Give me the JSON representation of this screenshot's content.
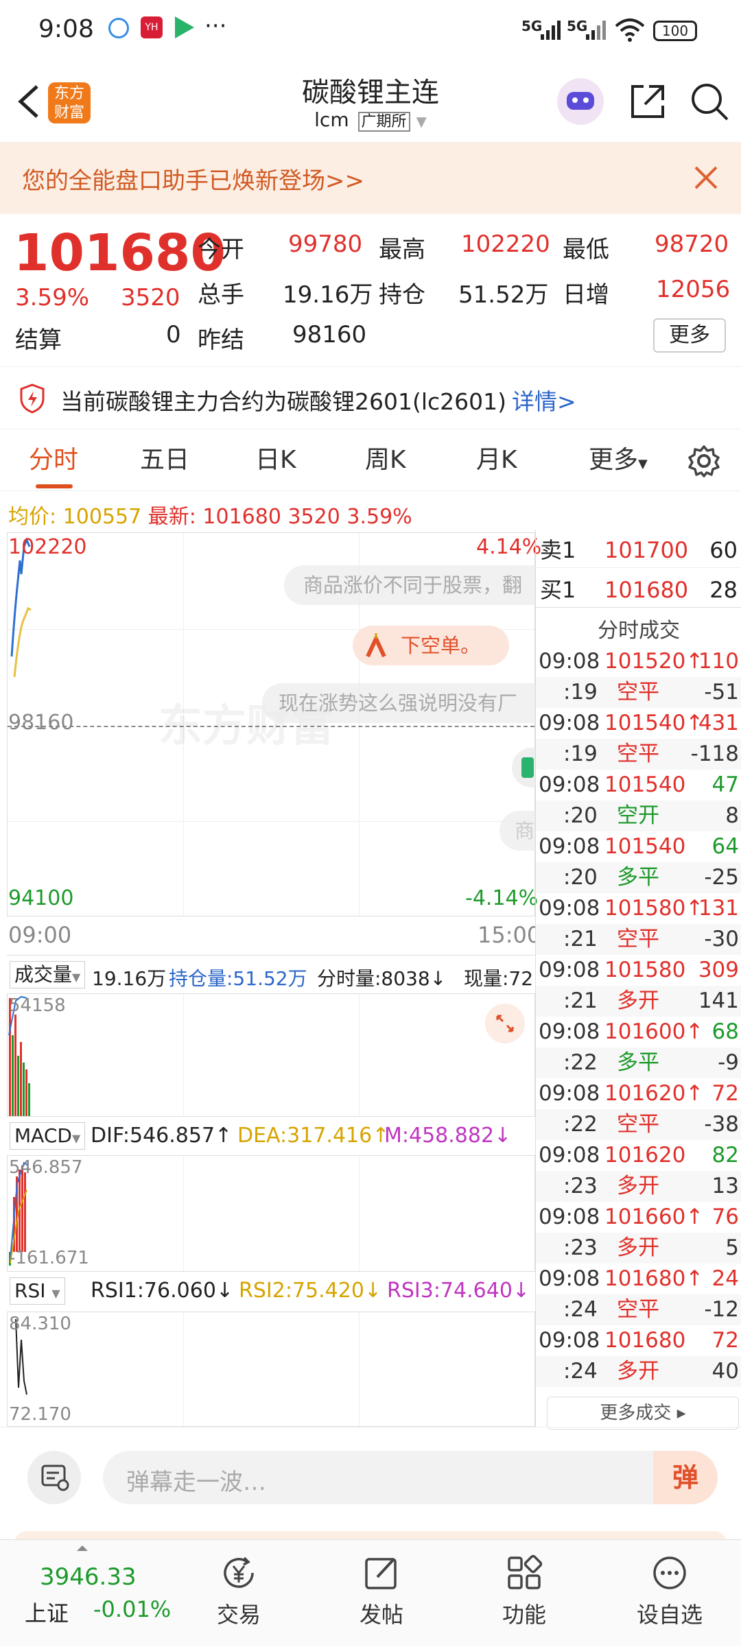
{
  "status": {
    "time": "9:08",
    "net1": "5G",
    "net2": "5G",
    "battery": "100"
  },
  "header": {
    "logo": "东方财富",
    "title": "碳酸锂主连",
    "code": "lcm",
    "exchange": "广期所"
  },
  "banner": {
    "text": "您的全能盘口助手已焕新登场>>"
  },
  "quote": {
    "price": "101680",
    "change_pct": "3.59%",
    "change": "3520",
    "open_label": "今开",
    "open": "99780",
    "high_label": "最高",
    "high": "102220",
    "low_label": "最低",
    "low": "98720",
    "volume_label": "总手",
    "volume": "19.16万",
    "oi_label": "持仓",
    "oi": "51.52万",
    "daily_inc_label": "日增",
    "daily_inc": "12056",
    "settle_label": "结算",
    "settle": "0",
    "prev_settle_label": "昨结",
    "prev_settle": "98160",
    "more_label": "更多"
  },
  "notice": {
    "text": "当前碳酸锂主力合约为碳酸锂2601(lc2601)",
    "link": "详情>"
  },
  "tabs": [
    "分时",
    "五日",
    "日K",
    "周K",
    "月K",
    "更多"
  ],
  "avg": {
    "avg_label": "均价:",
    "avg": "100557",
    "latest_label": "最新:",
    "latest": "101680",
    "chg": "3520",
    "pct": "3.59%"
  },
  "chart": {
    "top_price": "102220",
    "top_pct": "4.14%",
    "mid_price": "98160",
    "bottom_price": "94100",
    "bottom_pct": "-4.14%",
    "start_time": "09:00",
    "end_time": "15:00",
    "danmu1": "商品涨价不同于股票，翻",
    "danmu2": "下空单。",
    "danmu3": "现在涨势这么强说明没有厂",
    "danmu4": "商",
    "watermark": "东方财富"
  },
  "volume": {
    "label": "成交量",
    "total": "19.16万",
    "oi": "持仓量:51.52万",
    "min_vol": "分时量:8038↓",
    "cur": "现量:72",
    "max": "54158"
  },
  "macd": {
    "label": "MACD",
    "dif": "DIF:546.857↑",
    "dea": "DEA:317.416↑",
    "m": "M:458.882↓",
    "max": "546.857",
    "min": "-161.671"
  },
  "rsi": {
    "label": "RSI",
    "rsi1": "RSI1:76.060↓",
    "rsi2": "RSI2:75.420↓",
    "rsi3": "RSI3:74.640↓",
    "max": "84.310",
    "min": "72.170"
  },
  "orderbook": {
    "sell_label": "卖1",
    "sell_price": "101700",
    "sell_vol": "60",
    "buy_label": "买1",
    "buy_price": "101680",
    "buy_vol": "28",
    "ticks_title": "分时成交"
  },
  "ticks": [
    {
      "a": "09:08",
      "b": "101520↑",
      "c": "110",
      "bc": "red",
      "cc": "red"
    },
    {
      "a": ":19",
      "b": "空平",
      "c": "-51",
      "bc": "red",
      "cc": "dark"
    },
    {
      "a": "09:08",
      "b": "101540↑",
      "c": "431",
      "bc": "red",
      "cc": "red"
    },
    {
      "a": ":19",
      "b": "空平",
      "c": "-118",
      "bc": "red",
      "cc": "dark"
    },
    {
      "a": "09:08",
      "b": "101540",
      "c": "47",
      "bc": "red",
      "cc": "green"
    },
    {
      "a": ":20",
      "b": "空开",
      "c": "8",
      "bc": "green",
      "cc": "dark"
    },
    {
      "a": "09:08",
      "b": "101540",
      "c": "64",
      "bc": "red",
      "cc": "green"
    },
    {
      "a": ":20",
      "b": "多平",
      "c": "-25",
      "bc": "green",
      "cc": "dark"
    },
    {
      "a": "09:08",
      "b": "101580↑",
      "c": "131",
      "bc": "red",
      "cc": "red"
    },
    {
      "a": ":21",
      "b": "空平",
      "c": "-30",
      "bc": "red",
      "cc": "dark"
    },
    {
      "a": "09:08",
      "b": "101580",
      "c": "309",
      "bc": "red",
      "cc": "red"
    },
    {
      "a": ":21",
      "b": "多开",
      "c": "141",
      "bc": "red",
      "cc": "dark"
    },
    {
      "a": "09:08",
      "b": "101600↑",
      "c": "68",
      "bc": "red",
      "cc": "green"
    },
    {
      "a": ":22",
      "b": "多平",
      "c": "-9",
      "bc": "green",
      "cc": "dark"
    },
    {
      "a": "09:08",
      "b": "101620↑",
      "c": "72",
      "bc": "red",
      "cc": "red"
    },
    {
      "a": ":22",
      "b": "空平",
      "c": "-38",
      "bc": "red",
      "cc": "dark"
    },
    {
      "a": "09:08",
      "b": "101620",
      "c": "82",
      "bc": "red",
      "cc": "green"
    },
    {
      "a": ":23",
      "b": "多开",
      "c": "13",
      "bc": "red",
      "cc": "dark"
    },
    {
      "a": "09:08",
      "b": "101660↑",
      "c": "76",
      "bc": "red",
      "cc": "red"
    },
    {
      "a": ":23",
      "b": "多开",
      "c": "5",
      "bc": "red",
      "cc": "dark"
    },
    {
      "a": "09:08",
      "b": "101680↑",
      "c": "24",
      "bc": "red",
      "cc": "red"
    },
    {
      "a": ":24",
      "b": "空平",
      "c": "-12",
      "bc": "red",
      "cc": "dark"
    },
    {
      "a": "09:08",
      "b": "101680",
      "c": "72",
      "bc": "red",
      "cc": "red"
    },
    {
      "a": ":24",
      "b": "多开",
      "c": "40",
      "bc": "red",
      "cc": "dark"
    }
  ],
  "more_ticks": "更多成交 ▸",
  "danmu_input": {
    "placeholder": "弹幕走一波…",
    "send": "弹"
  },
  "bottom_nav": {
    "index_value": "3946.33",
    "index_name": "上证",
    "index_change": "-0.01%",
    "trade": "交易",
    "post": "发帖",
    "functions": "功能",
    "watchlist": "设自选"
  }
}
